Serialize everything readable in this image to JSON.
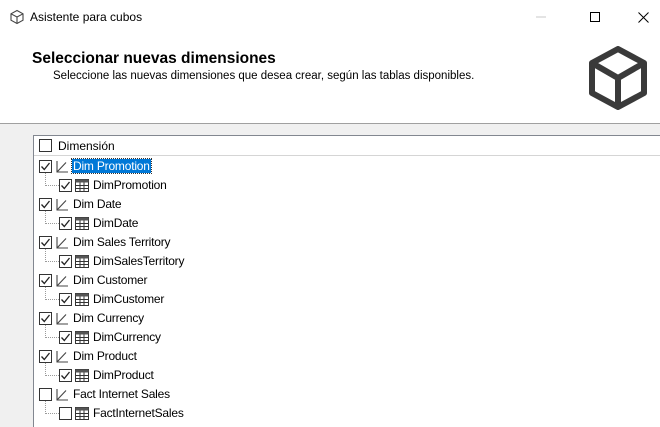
{
  "window": {
    "title": "Asistente para cubos",
    "icon": "cube-icon",
    "buttons": {
      "minimize": "minimize-icon",
      "maximize": "maximize-icon",
      "close": "close-icon"
    }
  },
  "header": {
    "title": "Seleccionar nuevas dimensiones",
    "subtitle": "Seleccione las nuevas dimensiones que desea crear, según las tablas disponibles.",
    "logo": "cube-logo-icon"
  },
  "tree": {
    "column_header": "Dimensión",
    "header_checked": false,
    "accent": "#0078d7",
    "items": [
      {
        "label": "Dim Promotion",
        "checked": true,
        "selected": true,
        "table": {
          "label": "DimPromotion",
          "checked": true
        }
      },
      {
        "label": "Dim Date",
        "checked": true,
        "selected": false,
        "table": {
          "label": "DimDate",
          "checked": true
        }
      },
      {
        "label": "Dim Sales Territory",
        "checked": true,
        "selected": false,
        "table": {
          "label": "DimSalesTerritory",
          "checked": true
        }
      },
      {
        "label": "Dim Customer",
        "checked": true,
        "selected": false,
        "table": {
          "label": "DimCustomer",
          "checked": true
        }
      },
      {
        "label": "Dim Currency",
        "checked": true,
        "selected": false,
        "table": {
          "label": "DimCurrency",
          "checked": true
        }
      },
      {
        "label": "Dim Product",
        "checked": true,
        "selected": false,
        "table": {
          "label": "DimProduct",
          "checked": true
        }
      },
      {
        "label": "Fact Internet Sales",
        "checked": false,
        "selected": false,
        "table": {
          "label": "FactInternetSales",
          "checked": false
        }
      }
    ]
  }
}
